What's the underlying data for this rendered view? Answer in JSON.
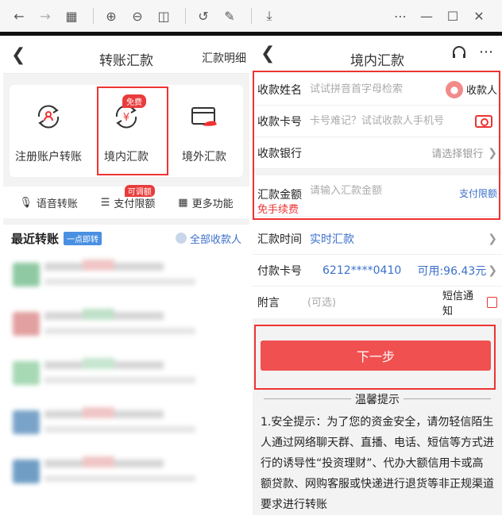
{
  "left": {
    "title": "转账汇款",
    "detail_link": "汇款明细",
    "cards": [
      {
        "label": "注册账户转账"
      },
      {
        "label": "境内汇款",
        "badge": "免费"
      },
      {
        "label": "境外汇款"
      }
    ],
    "quick": [
      {
        "label": "语音转账"
      },
      {
        "label": "支付限额",
        "badge": "可调额"
      },
      {
        "label": "更多功能"
      }
    ],
    "recent": {
      "title": "最近转账",
      "tag": "一点即转",
      "all": "全部收款人"
    }
  },
  "right": {
    "title": "境内汇款",
    "payee_name": {
      "label": "收款姓名",
      "placeholder": "试试拼音首字母检索",
      "action": "收款人"
    },
    "payee_card": {
      "label": "收款卡号",
      "placeholder": "卡号难记？试试收款人手机号"
    },
    "payee_bank": {
      "label": "收款银行",
      "value": "请选择银行"
    },
    "amount": {
      "label": "汇款金额",
      "placeholder": "请输入汇款金额",
      "limit_link": "支付限额",
      "free": "免手续费"
    },
    "time": {
      "label": "汇款时间",
      "value": "实时汇款"
    },
    "pay_card": {
      "label": "付款卡号",
      "card": "6212****0410",
      "available": "可用:96.43元"
    },
    "note": {
      "label": "附言",
      "placeholder": "(可选)",
      "sms": "短信通知"
    },
    "next_button": "下一步",
    "tips": {
      "title": "温馨提示",
      "body": "1.安全提示：为了您的资金安全，请勿轻信陌生人通过网络聊天群、直播、电话、短信等方式进行的诱导性“投资理财”、代办大额信用卡或高额贷款、网购客服或快递进行退货等非正规渠道要求进行转账"
    }
  }
}
